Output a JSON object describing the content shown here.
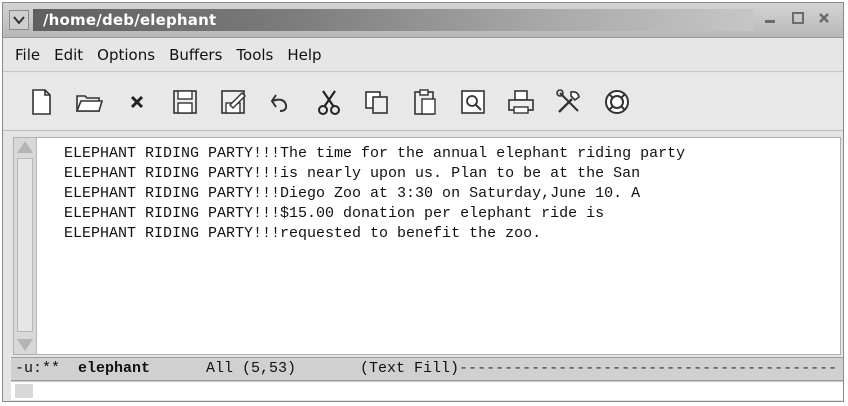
{
  "window": {
    "title": "/home/deb/elephant",
    "controls": [
      "minimize-icon",
      "maximize-icon",
      "close-icon"
    ]
  },
  "menubar": {
    "items": [
      "File",
      "Edit",
      "Options",
      "Buffers",
      "Tools",
      "Help"
    ]
  },
  "toolbar": {
    "icons": [
      "new-file-icon",
      "open-folder-icon",
      "close-buffer-icon",
      "save-icon",
      "save-as-icon",
      "undo-icon",
      "cut-icon",
      "copy-icon",
      "paste-icon",
      "search-icon",
      "print-icon",
      "customize-icon",
      "help-icon"
    ]
  },
  "buffer": {
    "lines": [
      "ELEPHANT RIDING PARTY!!!The time for the annual elephant riding party",
      "ELEPHANT RIDING PARTY!!!is nearly upon us. Plan to be at the San",
      "ELEPHANT RIDING PARTY!!!Diego Zoo at 3:30 on Saturday,June 10. A",
      "ELEPHANT RIDING PARTY!!!$15.00 donation per elephant ride is",
      "ELEPHANT RIDING PARTY!!!requested to benefit the zoo."
    ]
  },
  "modeline": {
    "status": "-u:**",
    "buffer_name": "elephant",
    "position": "All (5,53)",
    "mode": "(Text Fill)",
    "dashes": "------------------------------------------"
  },
  "colors": {
    "title_gradient_start": "#5f5f5f",
    "title_gradient_end": "#c6c6c6",
    "chrome": "#e4e4e4",
    "modeline_bg": "#d0d0d0"
  }
}
